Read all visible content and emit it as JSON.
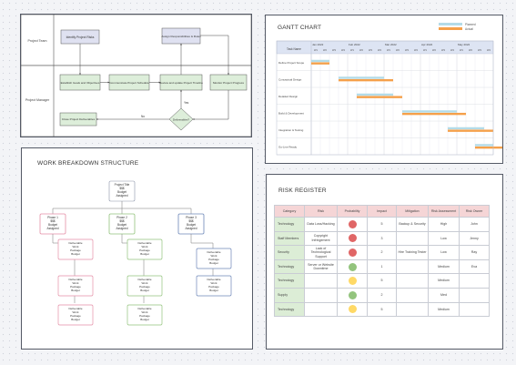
{
  "process_flow": {
    "lanes": [
      "Project Team",
      "Project Manager"
    ],
    "nodes": {
      "identify": "Identify Project Risks",
      "assess": "Assign Responsibilities & Roles",
      "establish": "Establish Goals and Objectives",
      "communicate": "Communicate Project Schedule",
      "review": "Review and update Project Timeline",
      "monitor": "Monitor Project Progress",
      "close": "Close Project Deliverables",
      "decision": "Deliverables?"
    },
    "edge_labels": {
      "yes": "Yes",
      "no": "No"
    }
  },
  "gantt": {
    "title": "GANTT CHART",
    "legend": [
      "Planned",
      "Actual"
    ],
    "colors": {
      "planned": "#b3dbe8",
      "actual": "#f5a04a"
    },
    "header_label": "Task Name",
    "months": [
      "Jan 2022",
      "Feb 2022",
      "Mar 2022",
      "Apr 2022",
      "May 2022"
    ],
    "weeks": [
      "W1",
      "W2",
      "W3",
      "W4"
    ],
    "tasks": [
      "Define Project Scope",
      "Conceptual Design",
      "Detailed Design",
      "Build & Development",
      "Integration & Testing",
      "Go-Live Ready"
    ]
  },
  "wbs": {
    "title": "WORK BREAKDOWN STRUCTURE",
    "root": "Project Title\n$$$\nBudget\nAssigned",
    "phases": [
      {
        "label": "Phase 1\n$$$\nBudget\nAssigned",
        "color": "#e58fa6"
      },
      {
        "label": "Phase 2\n$$$\nBudget\nAssigned",
        "color": "#93c47d"
      },
      {
        "label": "Phase 3\n$$$\nBudget\nAssigned",
        "color": "#6d87b8"
      }
    ],
    "deliverables": [
      [
        "Deliverable\nWork\nPackage\nBudget",
        "Deliverable\nWork\nPackage\nBudget",
        "Deliverable\nWork\nPackage\nBudget"
      ],
      [
        "Deliverable\nWork\nPackage\nBudget",
        "Deliverable\nWork\nPackage\nBudget",
        "Deliverable\nWork\nPackage\nBudget"
      ],
      [
        "Deliverable\nWork\nPackage\nBudget",
        "Deliverable\nWork\nPackage\nBudget"
      ]
    ]
  },
  "risk": {
    "title": "RISK REGISTER",
    "headers": [
      "Category",
      "Risk",
      "Probability",
      "Impact",
      "Mitigation",
      "Risk Assessment",
      "Risk Owner"
    ],
    "colors": {
      "high": "#e06666",
      "medium": "#ffd966",
      "low": "#93c47d"
    },
    "rows": [
      {
        "category": "Technology",
        "risk": "Data Loss/Hacking",
        "level": "high",
        "impact": "5",
        "mitigation": "Backup & Security",
        "assessment": "High",
        "owner": "John"
      },
      {
        "category": "Staff Members",
        "risk": "Copyright Infringement",
        "level": "high",
        "impact": "3",
        "mitigation": "",
        "assessment": "Low",
        "owner": "Jenny"
      },
      {
        "category": "Security",
        "risk": "Lack of Technological Support",
        "level": "high",
        "impact": "2",
        "mitigation": "Hire Training Tester",
        "assessment": "Low",
        "owner": "Ray"
      },
      {
        "category": "Technology",
        "risk": "Server or Website Downtime",
        "level": "low",
        "impact": "1",
        "mitigation": "",
        "assessment": "Medium",
        "owner": "Eva"
      },
      {
        "category": "Technology",
        "risk": "",
        "level": "medium",
        "impact": "5",
        "mitigation": "",
        "assessment": "Medium",
        "owner": ""
      },
      {
        "category": "Supply",
        "risk": "",
        "level": "low",
        "impact": "2",
        "mitigation": "",
        "assessment": "Med",
        "owner": ""
      },
      {
        "category": "Technology",
        "risk": "",
        "level": "medium",
        "impact": "5",
        "mitigation": "",
        "assessment": "Medium",
        "owner": ""
      }
    ]
  }
}
